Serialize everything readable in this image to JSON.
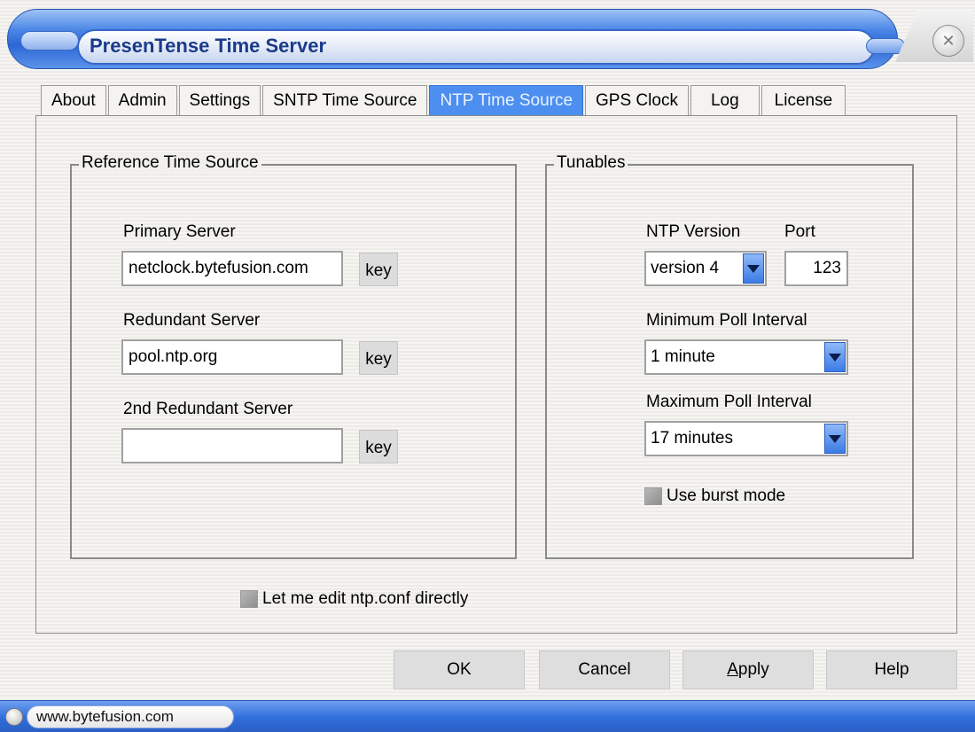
{
  "window": {
    "title": "PresenTense Time Server"
  },
  "tabs": [
    {
      "label": "About"
    },
    {
      "label": "Admin"
    },
    {
      "label": "Settings"
    },
    {
      "label": "SNTP Time Source"
    },
    {
      "label": "NTP Time Source",
      "active": true
    },
    {
      "label": "GPS Clock"
    },
    {
      "label": "Log"
    },
    {
      "label": "License"
    }
  ],
  "reference": {
    "title": "Reference Time Source",
    "primary_label": "Primary Server",
    "primary_value": "netclock.bytefusion.com",
    "redundant_label": "Redundant Server",
    "redundant_value": "pool.ntp.org",
    "second_redundant_label": "2nd Redundant Server",
    "second_redundant_value": "",
    "key_label": "key"
  },
  "tunables": {
    "title": "Tunables",
    "ntp_version_label": "NTP Version",
    "ntp_version_value": "version 4",
    "port_label": "Port",
    "port_value": "123",
    "min_poll_label": "Minimum Poll Interval",
    "min_poll_value": "1 minute",
    "max_poll_label": "Maximum Poll Interval",
    "max_poll_value": "17 minutes",
    "burst_label": "Use burst mode",
    "burst_checked": false
  },
  "edit_conf": {
    "label": "Let me edit ntp.conf directly",
    "checked": false
  },
  "buttons": {
    "ok": "OK",
    "cancel": "Cancel",
    "apply_mnemonic": "A",
    "apply_rest": "pply",
    "help": "Help"
  },
  "status": {
    "url": "www.bytefusion.com"
  },
  "colors": {
    "accent": "#4d8ff0",
    "title_text": "#1a3a8a"
  }
}
